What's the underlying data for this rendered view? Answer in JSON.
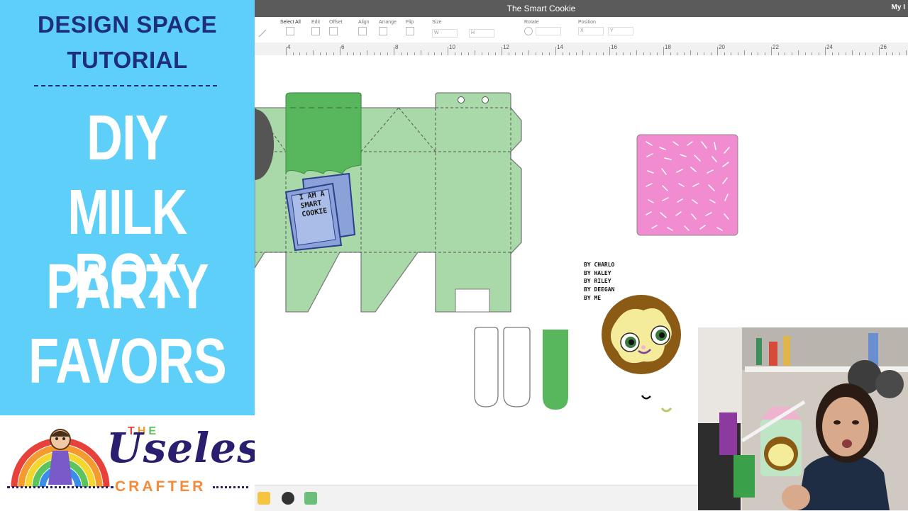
{
  "left_panel": {
    "header_line1": "DESIGN SPACE",
    "header_line2": "TUTORIAL",
    "title_lines": [
      "DIY",
      "MILK BOX",
      "PARTY",
      "FAVORS"
    ],
    "logo": {
      "the": "THE",
      "useless": "Useless",
      "crafter": "CRAFTER"
    }
  },
  "app": {
    "title": "The Smart Cookie",
    "account": "My I",
    "toolbar": {
      "select_all": "Select All",
      "edit": "Edit",
      "offset": "Offset",
      "align": "Align",
      "arrange": "Arrange",
      "flip": "Flip",
      "size": "Size",
      "size_w": "W",
      "size_h": "H",
      "rotate": "Rotate",
      "position": "Position",
      "position_x": "X",
      "position_y": "Y"
    },
    "ruler": [
      "4",
      "6",
      "8",
      "10",
      "12",
      "14",
      "16",
      "18",
      "20",
      "22",
      "24",
      "26"
    ]
  },
  "canvas": {
    "book_label": [
      "I AM A",
      "SMART",
      "COOKIE"
    ],
    "name_labels": [
      "BY CHARLO",
      "BY HALEY",
      "BY RILEY",
      "BY DEEGAN",
      "BY ME"
    ]
  },
  "colors": {
    "panel_blue": "#5ecff8",
    "panel_text": "#1d2f7a",
    "box_green": "#a9d9a8",
    "dark_green": "#58b75c",
    "pink": "#f18cd1",
    "cookie_brown": "#8b5a14",
    "book_blue": "#8aa2d8"
  },
  "icons": [
    "select-all-icon",
    "edit-icon",
    "offset-icon",
    "align-icon",
    "arrange-icon",
    "flip-icon",
    "rotate-icon",
    "lock-icon"
  ]
}
